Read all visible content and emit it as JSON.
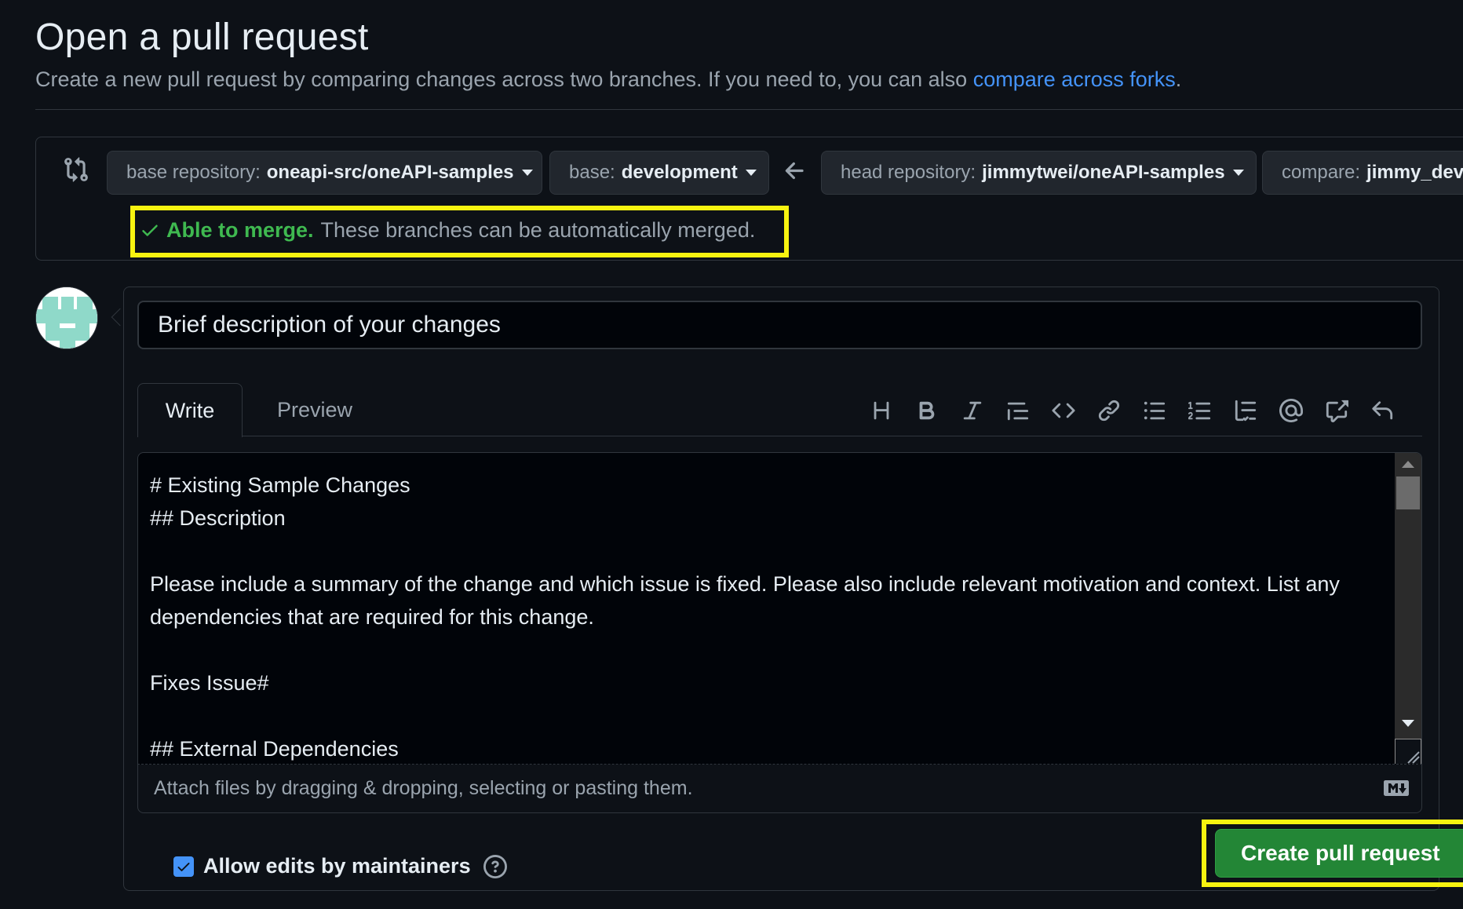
{
  "header": {
    "title": "Open a pull request",
    "subtitle": "Create a new pull request by comparing changes across two branches. If you need to, you can also ",
    "subtitle_link": "compare across forks",
    "subtitle_end": "."
  },
  "compare": {
    "base_repo_label": "base repository:",
    "base_repo_value": "oneapi-src/oneAPI-samples",
    "base_label": "base:",
    "base_value": "development",
    "head_repo_label": "head repository:",
    "head_repo_value": "jimmytwei/oneAPI-samples",
    "compare_label": "compare:",
    "compare_value": "jimmy_deve",
    "merge_ok": "Able to merge.",
    "merge_text": "These branches can be automatically merged."
  },
  "form": {
    "title_placeholder": "Brief description of your changes",
    "tabs": {
      "write": "Write",
      "preview": "Preview"
    },
    "toolbar_icons": [
      "heading-icon",
      "bold-icon",
      "italic-icon",
      "quote-icon",
      "code-icon",
      "link-icon",
      "unordered-list-icon",
      "ordered-list-icon",
      "task-list-icon",
      "mention-icon",
      "cross-reference-icon",
      "reply-icon"
    ],
    "body": "# Existing Sample Changes\n## Description\n\nPlease include a summary of the change and which issue is fixed. Please also include relevant motivation and context. List any\ndependencies that are required for this change.\n\nFixes Issue#\n\n## External Dependencies",
    "attach_text": "Attach files by dragging & dropping, selecting or pasting them.",
    "allow_edits_label": "Allow edits by maintainers",
    "allow_edits_checked": true,
    "create_button": "Create pull request"
  },
  "colors": {
    "background": "#0d1117",
    "link": "#4493f8",
    "success": "#3fb950",
    "primary_button": "#238636",
    "highlight": "#f7f310"
  }
}
